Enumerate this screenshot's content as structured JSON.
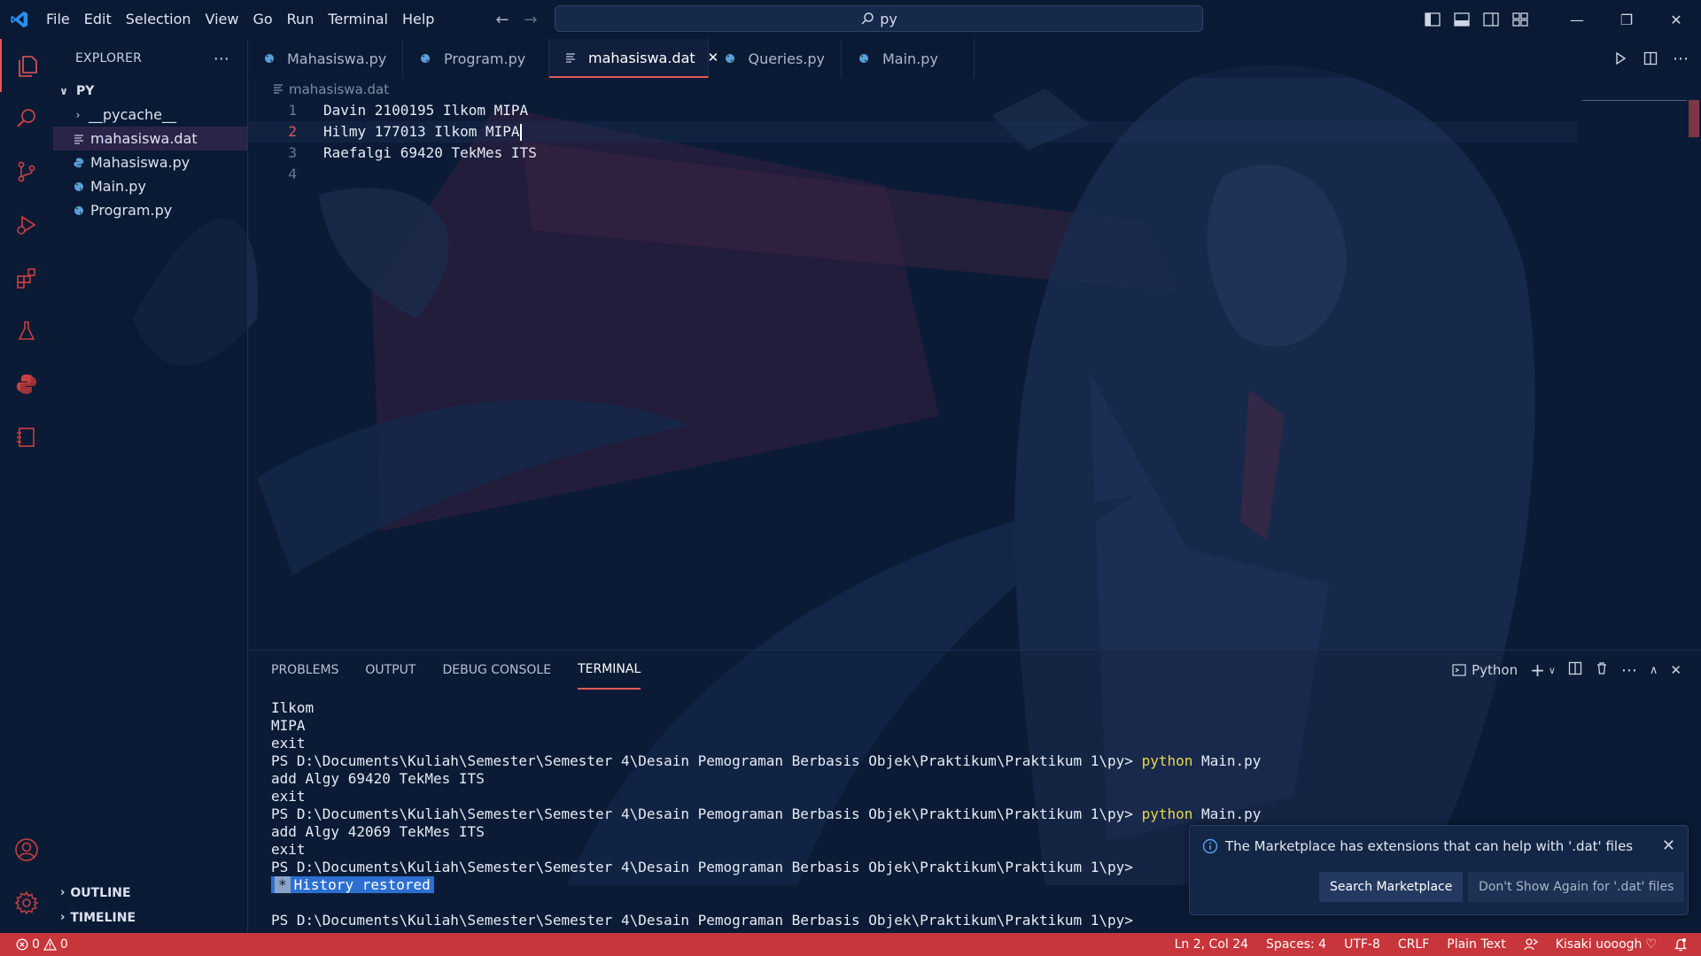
{
  "app": {
    "menu": [
      "File",
      "Edit",
      "Selection",
      "View",
      "Go",
      "Run",
      "Terminal",
      "Help"
    ],
    "search_text": "py",
    "colors": {
      "accent": "#e05a5a",
      "status_bar": "#c8353a",
      "vscode_blue": "#2a8ef0",
      "python_icon": "#5aa0d8"
    }
  },
  "sidebar": {
    "title": "EXPLORER",
    "folder": "PY",
    "items": [
      {
        "label": "__pycache__",
        "icon": "chevron-right-icon"
      },
      {
        "label": "mahasiswa.dat",
        "icon": "plain-text-file-icon"
      },
      {
        "label": "Mahasiswa.py",
        "icon": "python-file-icon"
      },
      {
        "label": "Main.py",
        "icon": "python-file-icon"
      },
      {
        "label": "Program.py",
        "icon": "python-file-icon"
      }
    ],
    "outline": "OUTLINE",
    "timeline": "TIMELINE"
  },
  "tabs": [
    {
      "label": "Mahasiswa.py",
      "icon": "python-file-icon"
    },
    {
      "label": "Program.py",
      "icon": "python-file-icon"
    },
    {
      "label": "mahasiswa.dat",
      "icon": "plain-text-file-icon"
    },
    {
      "label": "Queries.py",
      "icon": "python-file-icon"
    },
    {
      "label": "Main.py",
      "icon": "python-file-icon"
    }
  ],
  "editor": {
    "breadcrumb": "mahasiswa.dat",
    "lines": [
      {
        "number": "1",
        "text": "Davin 2100195 Ilkom MIPA"
      },
      {
        "number": "2",
        "text": "Hilmy 177013 Ilkom MIPA"
      },
      {
        "number": "3",
        "text": "Raefalgi 69420 TekMes ITS"
      },
      {
        "number": "4",
        "text": ""
      }
    ]
  },
  "panel": {
    "tabs": [
      "PROBLEMS",
      "OUTPUT",
      "DEBUG CONSOLE",
      "TERMINAL"
    ],
    "terminal_profile": "Python",
    "prompt": "PS D:\\Documents\\Kuliah\\Semester\\Semester 4\\Desain Pemograman Berbasis Objek\\Praktikum\\Praktikum 1\\py>",
    "cmd_python": "python",
    "cmd_arg": "Main.py",
    "output": {
      "l1": "Ilkom",
      "l2": "MIPA",
      "l3": "exit",
      "l5": "add Algy 69420 TekMes ITS",
      "l6": "exit",
      "l8": "add Algy 42069 TekMes ITS",
      "l9": "exit"
    },
    "history_star": "*",
    "history_text": "History restored"
  },
  "notification": {
    "message": "The Marketplace has extensions that can help with '.dat' files",
    "primary_button": "Search Marketplace",
    "secondary_button": "Don't Show Again for '.dat' files"
  },
  "statusbar": {
    "errors": "0",
    "warnings": "0",
    "position": "Ln 2, Col 24",
    "spaces": "Spaces: 4",
    "encoding": "UTF-8",
    "eol": "CRLF",
    "language": "Plain Text",
    "user": "Kisaki uooogh"
  }
}
